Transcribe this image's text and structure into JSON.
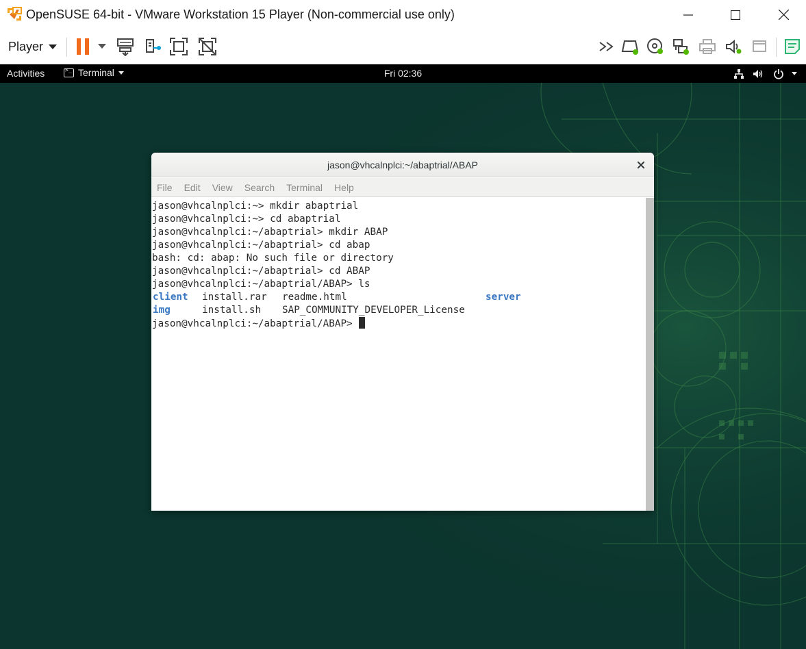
{
  "window": {
    "title": "OpenSUSE 64-bit - VMware Workstation 15 Player (Non-commercial use only)",
    "controls": [
      "minimize-icon",
      "maximize-icon",
      "close-icon"
    ]
  },
  "toolbar": {
    "player_label": "Player",
    "left_icons": [
      "pause-icon",
      "dropdown-icon",
      "send-ctrl-alt-del-icon",
      "unity-icon",
      "full-screen-icon",
      "fit-guest-icon"
    ],
    "right_icons": [
      "more-devices-icon",
      "hard-disk-icon",
      "cd-dvd-icon",
      "network-adapter-icon",
      "printer-icon",
      "sound-card-icon",
      "display-icon",
      "message-log-icon"
    ],
    "colors": {
      "pause": "#f26b1d",
      "device_active": "#53b800",
      "notes": "#2bb673"
    }
  },
  "gnome": {
    "activities": "Activities",
    "app_menu": "Terminal",
    "clock": "Fri 02:36",
    "tray_icons": [
      "network-icon",
      "volume-icon",
      "power-icon",
      "system-menu-caret-icon"
    ]
  },
  "terminal": {
    "title": "jason@vhcalnplci:~/abaptrial/ABAP",
    "menu": [
      "File",
      "Edit",
      "View",
      "Search",
      "Terminal",
      "Help"
    ],
    "lines": [
      "jason@vhcalnplci:~> mkdir abaptrial",
      "jason@vhcalnplci:~> cd abaptrial",
      "jason@vhcalnplci:~/abaptrial> mkdir ABAP",
      "jason@vhcalnplci:~/abaptrial> cd abap",
      "bash: cd: abap: No such file or directory",
      "jason@vhcalnplci:~/abaptrial> cd ABAP",
      "jason@vhcalnplci:~/abaptrial/ABAP> ls"
    ],
    "ls_output": [
      [
        "client",
        "install.rar",
        "readme.html",
        "server"
      ],
      [
        "img",
        "install.sh",
        "SAP_COMMUNITY_DEVELOPER_License"
      ]
    ],
    "prompt": "jason@vhcalnplci:~/abaptrial/ABAP> ",
    "colors": {
      "directory": "#3a78c2"
    }
  }
}
